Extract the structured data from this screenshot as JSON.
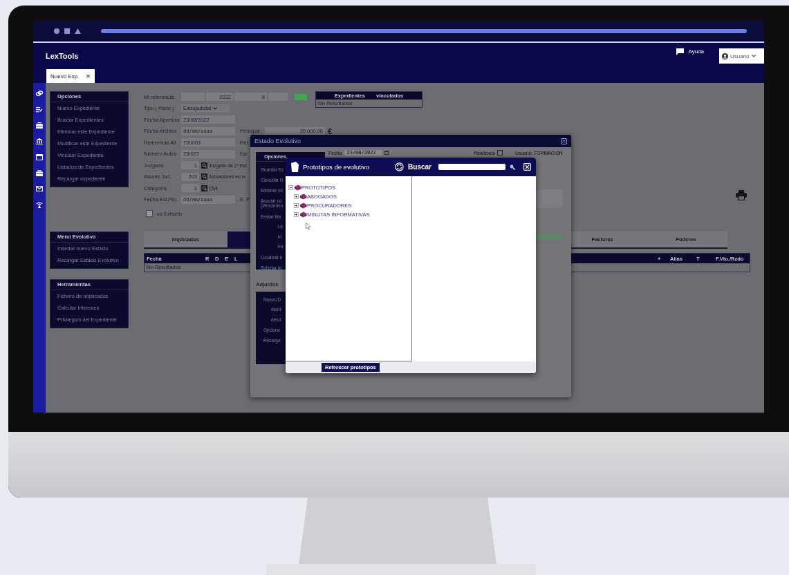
{
  "app": {
    "logo": "LexTools",
    "help": "Ayuda",
    "user": "Usuario"
  },
  "tabs": [
    {
      "label": "Nuevo Exp.",
      "close": "×",
      "selected": true
    }
  ],
  "menus": [
    {
      "title": "Opciones",
      "items": [
        "Nuevo Expediente",
        "Buscar Expedientes",
        "Eliminar este Expediente",
        "Modificar este Expediente",
        "Vincular Expediente",
        "Listados de Expedientes",
        "Recargar expediente"
      ]
    },
    {
      "title": "Menú Evolutivo",
      "items": [
        "Insertar nuevo Estado",
        "Recargar Estado Evolutivo"
      ]
    },
    {
      "title": "Herramientas",
      "items": [
        "Fichero de Implicados",
        "Calcular Intereses",
        "Privilegios del Expediente"
      ]
    }
  ],
  "form": {
    "rows": [
      {
        "kind": "reference",
        "label": "Mi referencia",
        "values": [
          "2022",
          "8"
        ]
      },
      {
        "kind": "select",
        "label": "Tipo ( Parte )",
        "value": "Extrajudicial"
      },
      {
        "kind": "text",
        "label": "Fecha Apertura",
        "value": "23/08/2022"
      },
      {
        "kind": "text",
        "label": "Fecha Archivo",
        "placeholder": "dd/mm/aaaa",
        "side_label": "Principal",
        "side_value": "20.000,00",
        "currency": "€"
      },
      {
        "kind": "text",
        "label": "Referencia Alt",
        "value": "720003",
        "side_label": "Ref."
      },
      {
        "kind": "text",
        "label": "Número Autos",
        "value": "23/022",
        "side_label": "Eje"
      },
      {
        "kind": "lookup",
        "label": "Juzgado",
        "value": "1",
        "description": "Juzgado de 1ª inst"
      },
      {
        "kind": "lookup",
        "label": "Asunto Jud.",
        "value": "203",
        "description": "Actuaciones en m"
      },
      {
        "kind": "lookup",
        "label": "Categoría",
        "value": "1",
        "description": "Civil"
      },
      {
        "kind": "text",
        "label": "Fecha Est.Pro.",
        "placeholder": "dd/mm/aaaa",
        "side_label": "E. P"
      },
      {
        "kind": "checkbox",
        "label": "es Exhorto",
        "checked": false
      }
    ]
  },
  "linked": {
    "title": "Expedientes vinculados",
    "empty": "Sin Resultados"
  },
  "detail_tabs": [
    {
      "label": "Implicados",
      "selected": false
    },
    {
      "selected": true
    },
    {
      "label": "Facturas",
      "selected": false
    },
    {
      "label": "Poderes",
      "selected": false
    }
  ],
  "table": {
    "columns": [
      "Fecha",
      "R",
      "D",
      "E",
      "L",
      "+",
      "Alias",
      "T",
      "F.Vto./Rzdo"
    ],
    "empty": "Sin Resultados"
  },
  "estado": {
    "title": "Estado Evolutivo",
    "options_title": "Opciones",
    "options": [
      {
        "kind": "item",
        "label": "Guardar Es"
      },
      {
        "kind": "item",
        "label": "Cancelar G"
      },
      {
        "kind": "item",
        "label": "Eliminar es"
      },
      {
        "kind": "item",
        "label": "Asociar co"
      },
      {
        "kind": "wrap",
        "label": "(Vencimien"
      },
      {
        "kind": "item",
        "label": "Enviar Me"
      },
      {
        "kind": "sub",
        "label": "Le"
      },
      {
        "kind": "sub",
        "label": "el"
      },
      {
        "kind": "sub",
        "label": "Fa"
      },
      {
        "kind": "item",
        "label": "Localizar e"
      },
      {
        "kind": "item",
        "label": "Solicitar In"
      }
    ],
    "date_label": "Fecha",
    "date": "23/08/2022",
    "done_label": "Realizado",
    "done": false,
    "user": "Usuario: FORMACION",
    "attachments_title": "Adjuntos",
    "attachments": [
      {
        "kind": "item",
        "label": "Nuevo D"
      },
      {
        "kind": "sub",
        "label": "desd"
      },
      {
        "kind": "sub",
        "label": "desd"
      },
      {
        "kind": "item",
        "label": "Opcione"
      },
      {
        "kind": "item",
        "label": "Recarga"
      }
    ]
  },
  "prototipos": {
    "title": "Prototipos de evolutivo",
    "search_label": "Buscar",
    "tree": [
      {
        "label": "PROTOTIPOS",
        "expanded": true,
        "children": [
          {
            "label": "ABOGADOS",
            "expanded": false
          },
          {
            "label": "PROCURADORES",
            "expanded": false
          },
          {
            "label": "MINUTAS INFORMATIVAS",
            "expanded": false
          }
        ]
      }
    ],
    "refresh_button": "Refrescar prototipos"
  }
}
